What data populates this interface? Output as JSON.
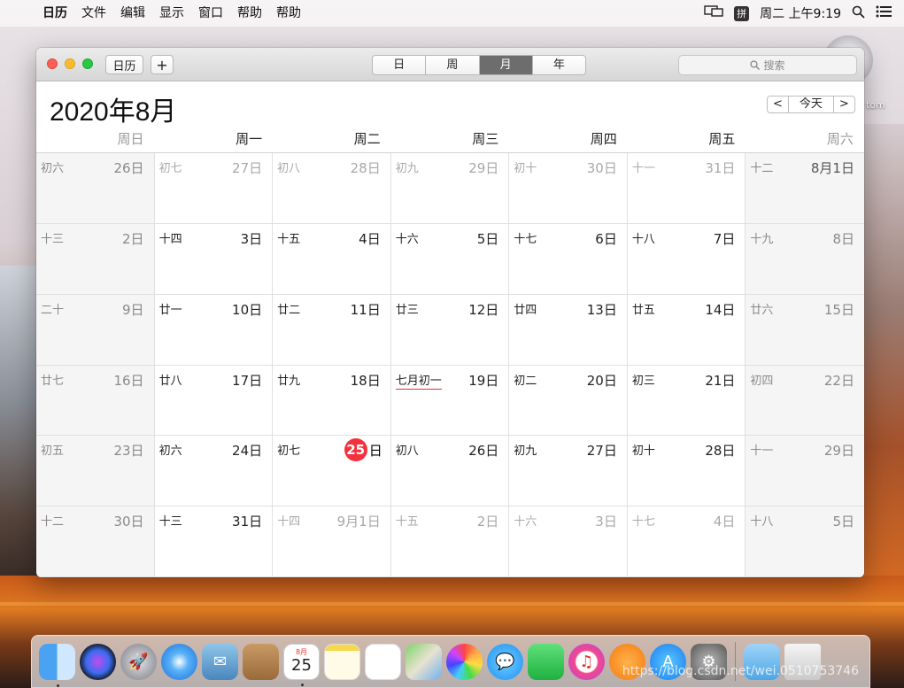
{
  "menubar": {
    "apple": "",
    "items": [
      "日历",
      "文件",
      "编辑",
      "显示",
      "窗口",
      "帮助",
      "帮助"
    ],
    "ime": "拼",
    "clock": "周二 上午9:19"
  },
  "window": {
    "calendars_button": "日历",
    "add_button": "+",
    "views": [
      "日",
      "周",
      "月",
      "年"
    ],
    "active_view": "月",
    "search_placeholder": "搜索",
    "month_title": "2020年8月",
    "nav_prev": "<",
    "nav_today": "今天",
    "nav_next": ">",
    "weekdays": [
      "周日",
      "周一",
      "周二",
      "周三",
      "周四",
      "周五",
      "周六"
    ]
  },
  "calendar": {
    "weeks": [
      [
        {
          "lunar": "初六",
          "day": "26日"
        },
        {
          "lunar": "初七",
          "day": "27日"
        },
        {
          "lunar": "初八",
          "day": "28日"
        },
        {
          "lunar": "初九",
          "day": "29日"
        },
        {
          "lunar": "初十",
          "day": "30日"
        },
        {
          "lunar": "十一",
          "day": "31日"
        },
        {
          "lunar": "十二",
          "day": "8月1日"
        }
      ],
      [
        {
          "lunar": "十三",
          "day": "2日"
        },
        {
          "lunar": "十四",
          "day": "3日"
        },
        {
          "lunar": "十五",
          "day": "4日"
        },
        {
          "lunar": "十六",
          "day": "5日"
        },
        {
          "lunar": "十七",
          "day": "6日"
        },
        {
          "lunar": "十八",
          "day": "7日"
        },
        {
          "lunar": "十九",
          "day": "8日"
        }
      ],
      [
        {
          "lunar": "二十",
          "day": "9日"
        },
        {
          "lunar": "廿一",
          "day": "10日"
        },
        {
          "lunar": "廿二",
          "day": "11日"
        },
        {
          "lunar": "廿三",
          "day": "12日"
        },
        {
          "lunar": "廿四",
          "day": "13日"
        },
        {
          "lunar": "廿五",
          "day": "14日"
        },
        {
          "lunar": "廿六",
          "day": "15日"
        }
      ],
      [
        {
          "lunar": "廿七",
          "day": "16日"
        },
        {
          "lunar": "廿八",
          "day": "17日"
        },
        {
          "lunar": "廿九",
          "day": "18日"
        },
        {
          "lunar": "七月初一",
          "day": "19日"
        },
        {
          "lunar": "初二",
          "day": "20日"
        },
        {
          "lunar": "初三",
          "day": "21日"
        },
        {
          "lunar": "初四",
          "day": "22日"
        }
      ],
      [
        {
          "lunar": "初五",
          "day": "23日"
        },
        {
          "lunar": "初六",
          "day": "24日"
        },
        {
          "lunar": "初七",
          "day": "25"
        },
        {
          "lunar": "初八",
          "day": "26日"
        },
        {
          "lunar": "初九",
          "day": "27日"
        },
        {
          "lunar": "初十",
          "day": "28日"
        },
        {
          "lunar": "十一",
          "day": "29日"
        }
      ],
      [
        {
          "lunar": "十二",
          "day": "30日"
        },
        {
          "lunar": "十三",
          "day": "31日"
        },
        {
          "lunar": "十四",
          "day": "9月1日"
        },
        {
          "lunar": "十五",
          "day": "2日"
        },
        {
          "lunar": "十六",
          "day": "3日"
        },
        {
          "lunar": "十七",
          "day": "4日"
        },
        {
          "lunar": "十八",
          "day": "5日"
        }
      ]
    ],
    "today_suffix": "日",
    "today_color": "#f5313d"
  },
  "desktop": {
    "disc_label": "tom"
  },
  "dock": {
    "calendar_icon_month": "8月",
    "calendar_icon_day": "25",
    "watermark": "https://blog.csdn.net/wei.0510753746"
  }
}
